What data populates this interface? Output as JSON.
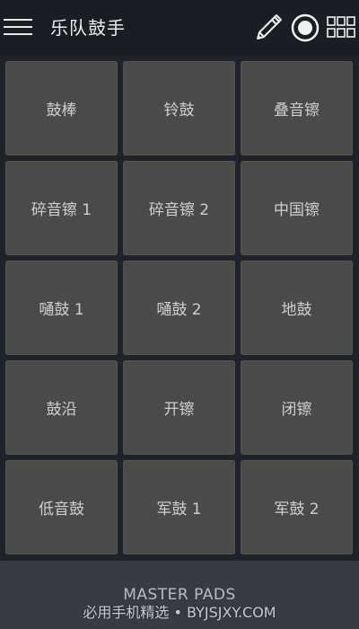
{
  "header": {
    "title": "乐队鼓手",
    "icons": {
      "menu": "hamburger-menu-icon",
      "edit": "pencil-icon",
      "record": "record-icon",
      "grid": "grid-icon"
    }
  },
  "pads": [
    {
      "label": "鼓棒"
    },
    {
      "label": "铃鼓"
    },
    {
      "label": "叠音镲"
    },
    {
      "label": "碎音镲 1"
    },
    {
      "label": "碎音镲 2"
    },
    {
      "label": "中国镲"
    },
    {
      "label": "嗵鼓 1"
    },
    {
      "label": "嗵鼓 2"
    },
    {
      "label": "地鼓"
    },
    {
      "label": "鼓沿"
    },
    {
      "label": "开镲"
    },
    {
      "label": "闭镲"
    },
    {
      "label": "低音鼓"
    },
    {
      "label": "军鼓 1"
    },
    {
      "label": "军鼓 2"
    }
  ],
  "footer": {
    "label": "MASTER PADS",
    "watermark": "必用手机精选 • BYJSJXY.COM"
  },
  "colors": {
    "background": "#1e2228",
    "pad": "#4a4b48",
    "pad_text": "#cfcfcf",
    "footer": "#373b44"
  }
}
